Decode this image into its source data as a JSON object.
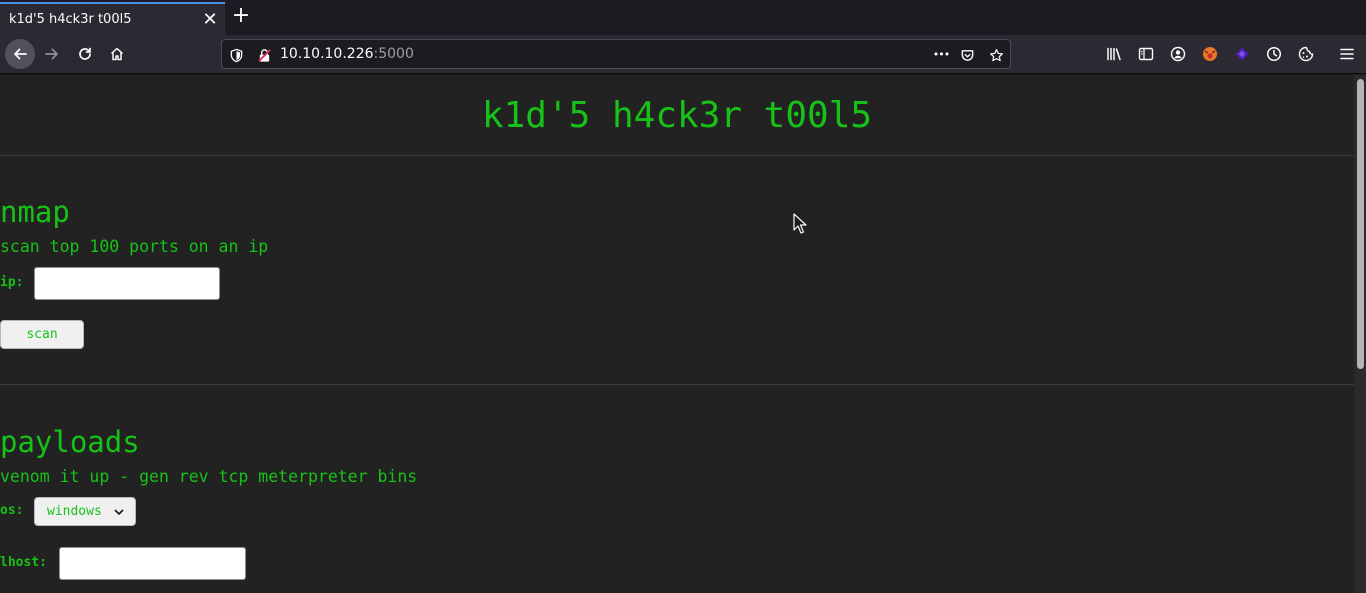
{
  "browser": {
    "tab_title": "k1d'5 h4ck3r t00l5",
    "tab_close_glyph": "✕",
    "new_tab_glyph": "+",
    "url_host": "10.10.10.226",
    "url_port": ":5000",
    "url_dots_glyph": "•••"
  },
  "page": {
    "title": "k1d'5 h4ck3r t00l5",
    "accent_color": "#17c217",
    "background_color": "#222222"
  },
  "nmap": {
    "heading": "nmap",
    "description": "scan top 100 ports on an ip",
    "ip_label": "ip:",
    "ip_value": "",
    "scan_label": "scan"
  },
  "payloads": {
    "heading": "payloads",
    "description": "venom it up - gen rev tcp meterpreter bins",
    "os_label": "os:",
    "os_selected": "windows",
    "lhost_label": "lhost:",
    "lhost_value": ""
  }
}
